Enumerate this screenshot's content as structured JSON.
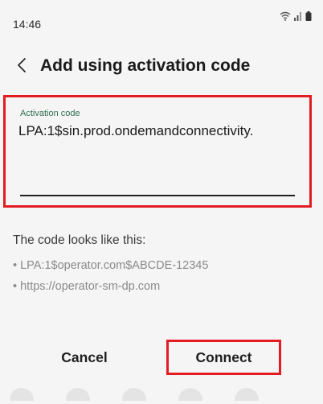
{
  "status_bar": {
    "time": "14:46",
    "icons": [
      "wifi-icon",
      "signal-icon",
      "battery-icon"
    ]
  },
  "header": {
    "back_icon": "back-chevron-icon",
    "title": "Add using activation code"
  },
  "activation_field": {
    "label": "Activation code",
    "value": "LPA:1$sin.prod.ondemandconnectivity."
  },
  "hint": {
    "title": "The code looks like this:",
    "examples": [
      "• LPA:1$operator.com$ABCDE-12345",
      "• https://operator-sm-dp.com"
    ]
  },
  "buttons": {
    "cancel_label": "Cancel",
    "connect_label": "Connect"
  },
  "colors": {
    "highlight_border": "#e31b23",
    "label_accent": "#2f6f4e",
    "background": "#f5f5f5"
  }
}
